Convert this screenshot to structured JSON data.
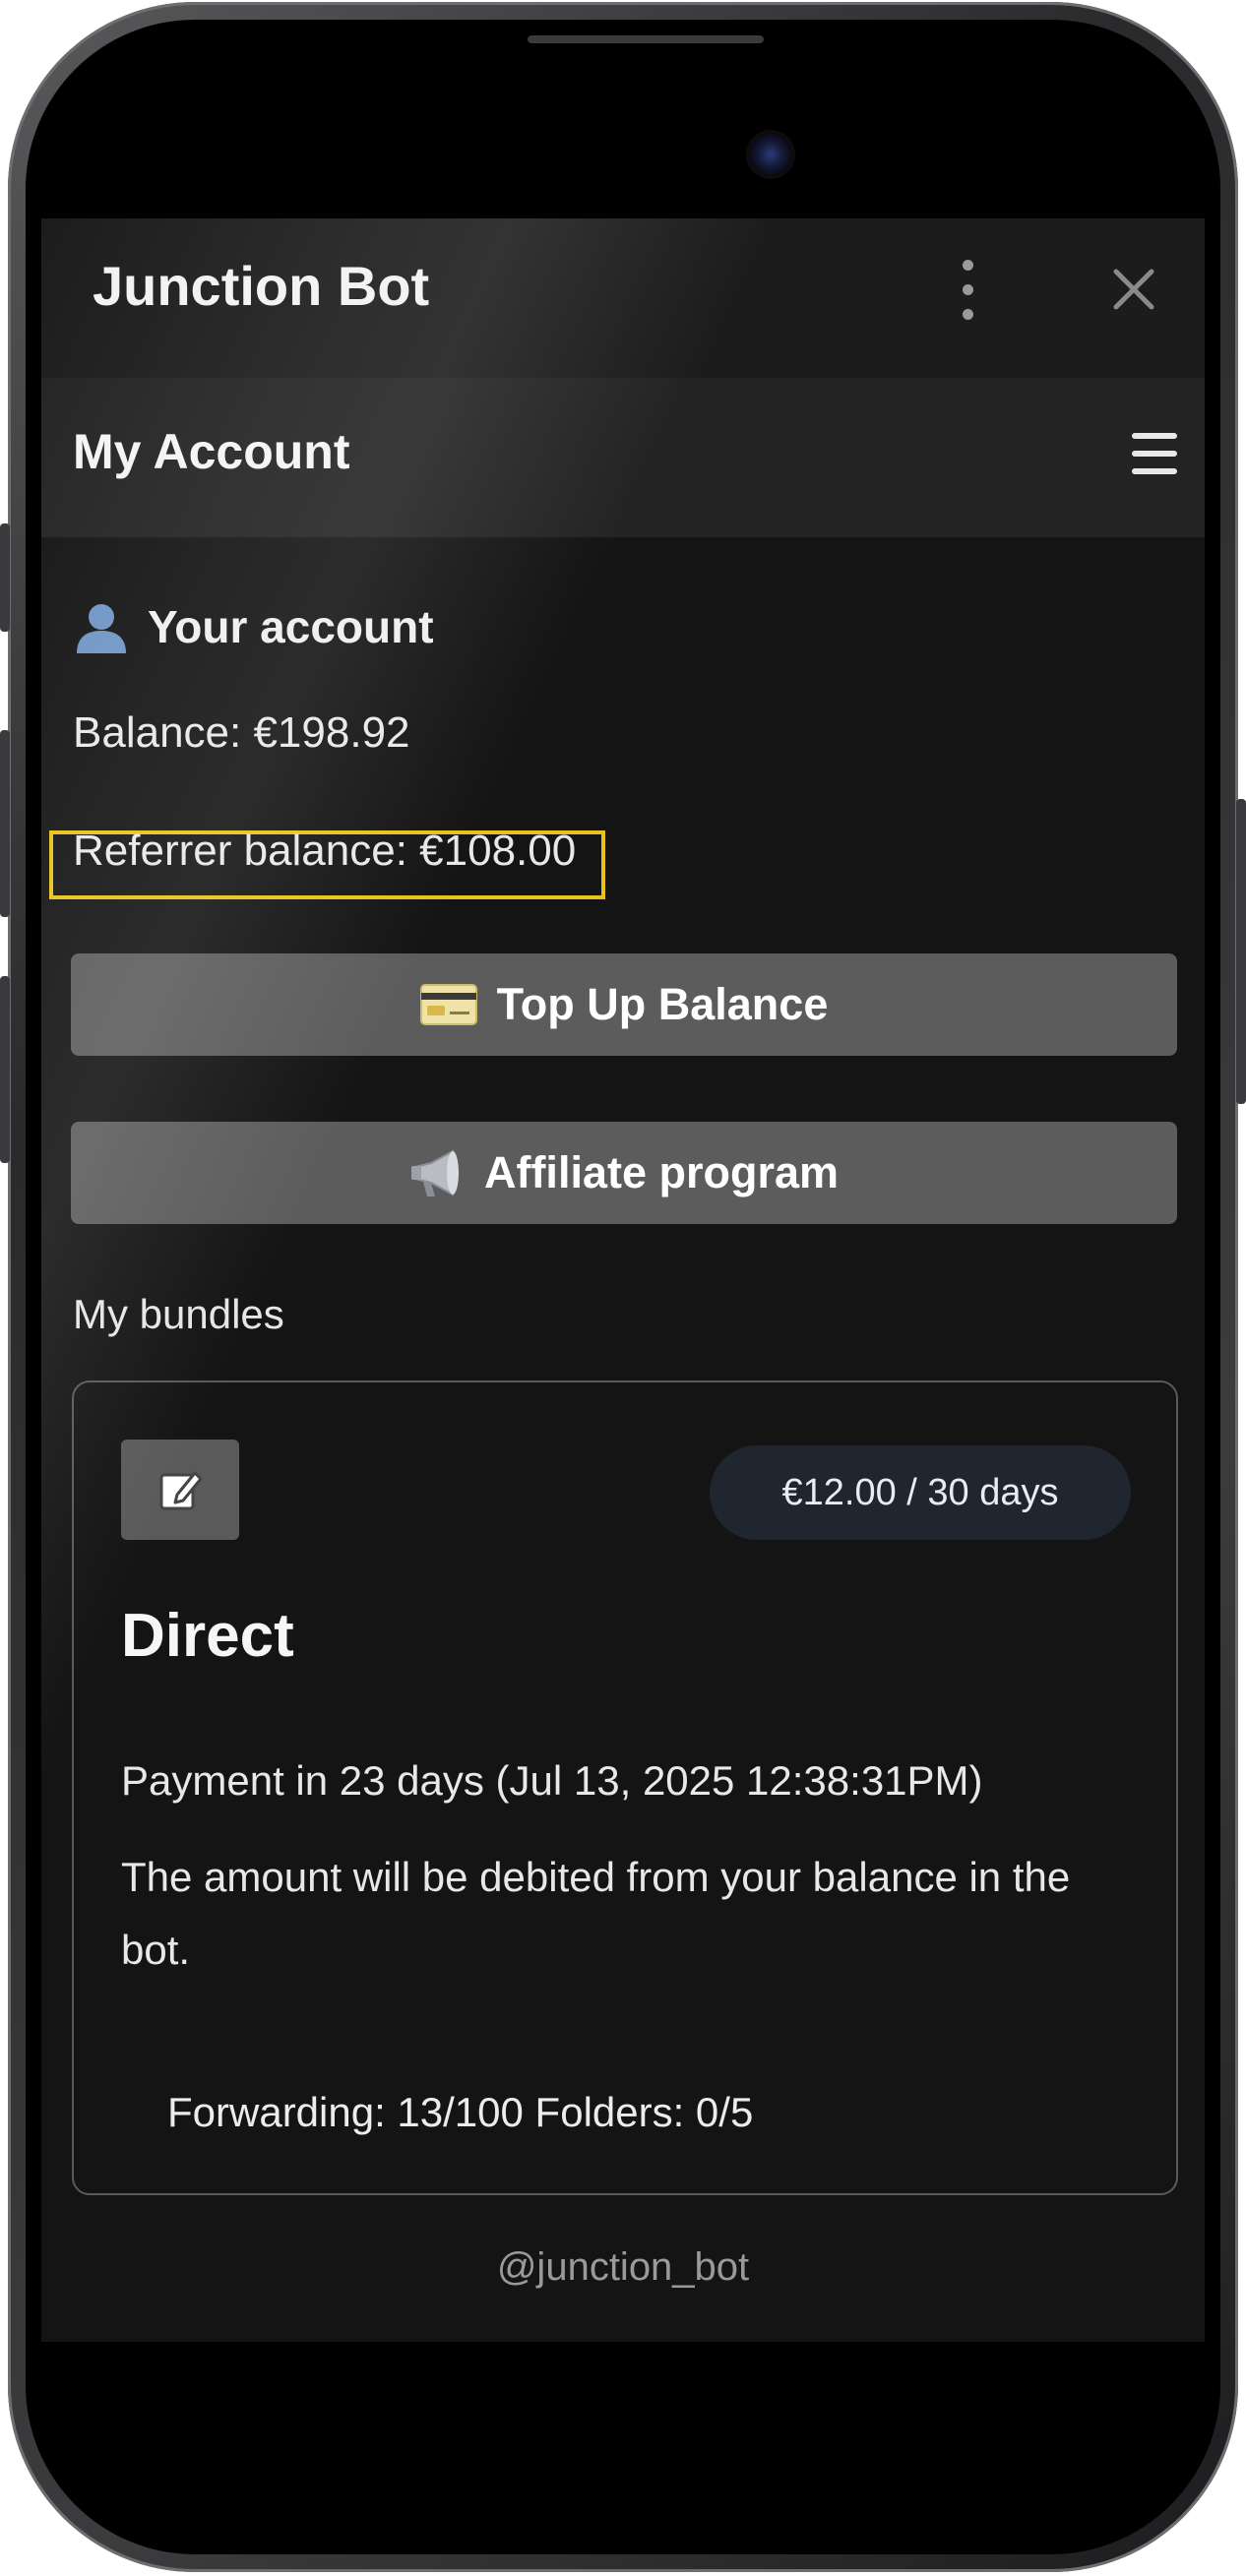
{
  "topbar": {
    "title": "Junction Bot",
    "menu_icon": "kebab-menu-icon",
    "close_icon": "close-icon"
  },
  "header": {
    "title": "My Account",
    "menu_icon": "hamburger-menu-icon"
  },
  "account": {
    "section_icon": "user-silhouette-icon",
    "section_title": "Your account",
    "balance": "Balance: €198.92",
    "referrer_balance": "Referrer balance: €108.00",
    "highlight_color": "#e8c21a"
  },
  "buttons": {
    "top_up": {
      "icon": "credit-card-icon",
      "label": "Top Up Balance"
    },
    "affiliate": {
      "icon": "megaphone-icon",
      "label": "Affiliate program"
    }
  },
  "bundles": {
    "label": "My bundles",
    "items": [
      {
        "edit_icon": "edit-icon",
        "price": "€12.00 / 30 days",
        "name": "Direct",
        "payment": "Payment in 23 days (Jul 13, 2025 12:38:31PM)",
        "note": "The amount will be debited from your balance in the bot.",
        "stats": "Forwarding: 13/100 Folders: 0/5"
      }
    ]
  },
  "footer": {
    "handle": "@junction_bot"
  },
  "colors": {
    "screen_bg": "#141414",
    "button_bg": "#5c5c5c",
    "pill_bg": "#1f2630"
  }
}
